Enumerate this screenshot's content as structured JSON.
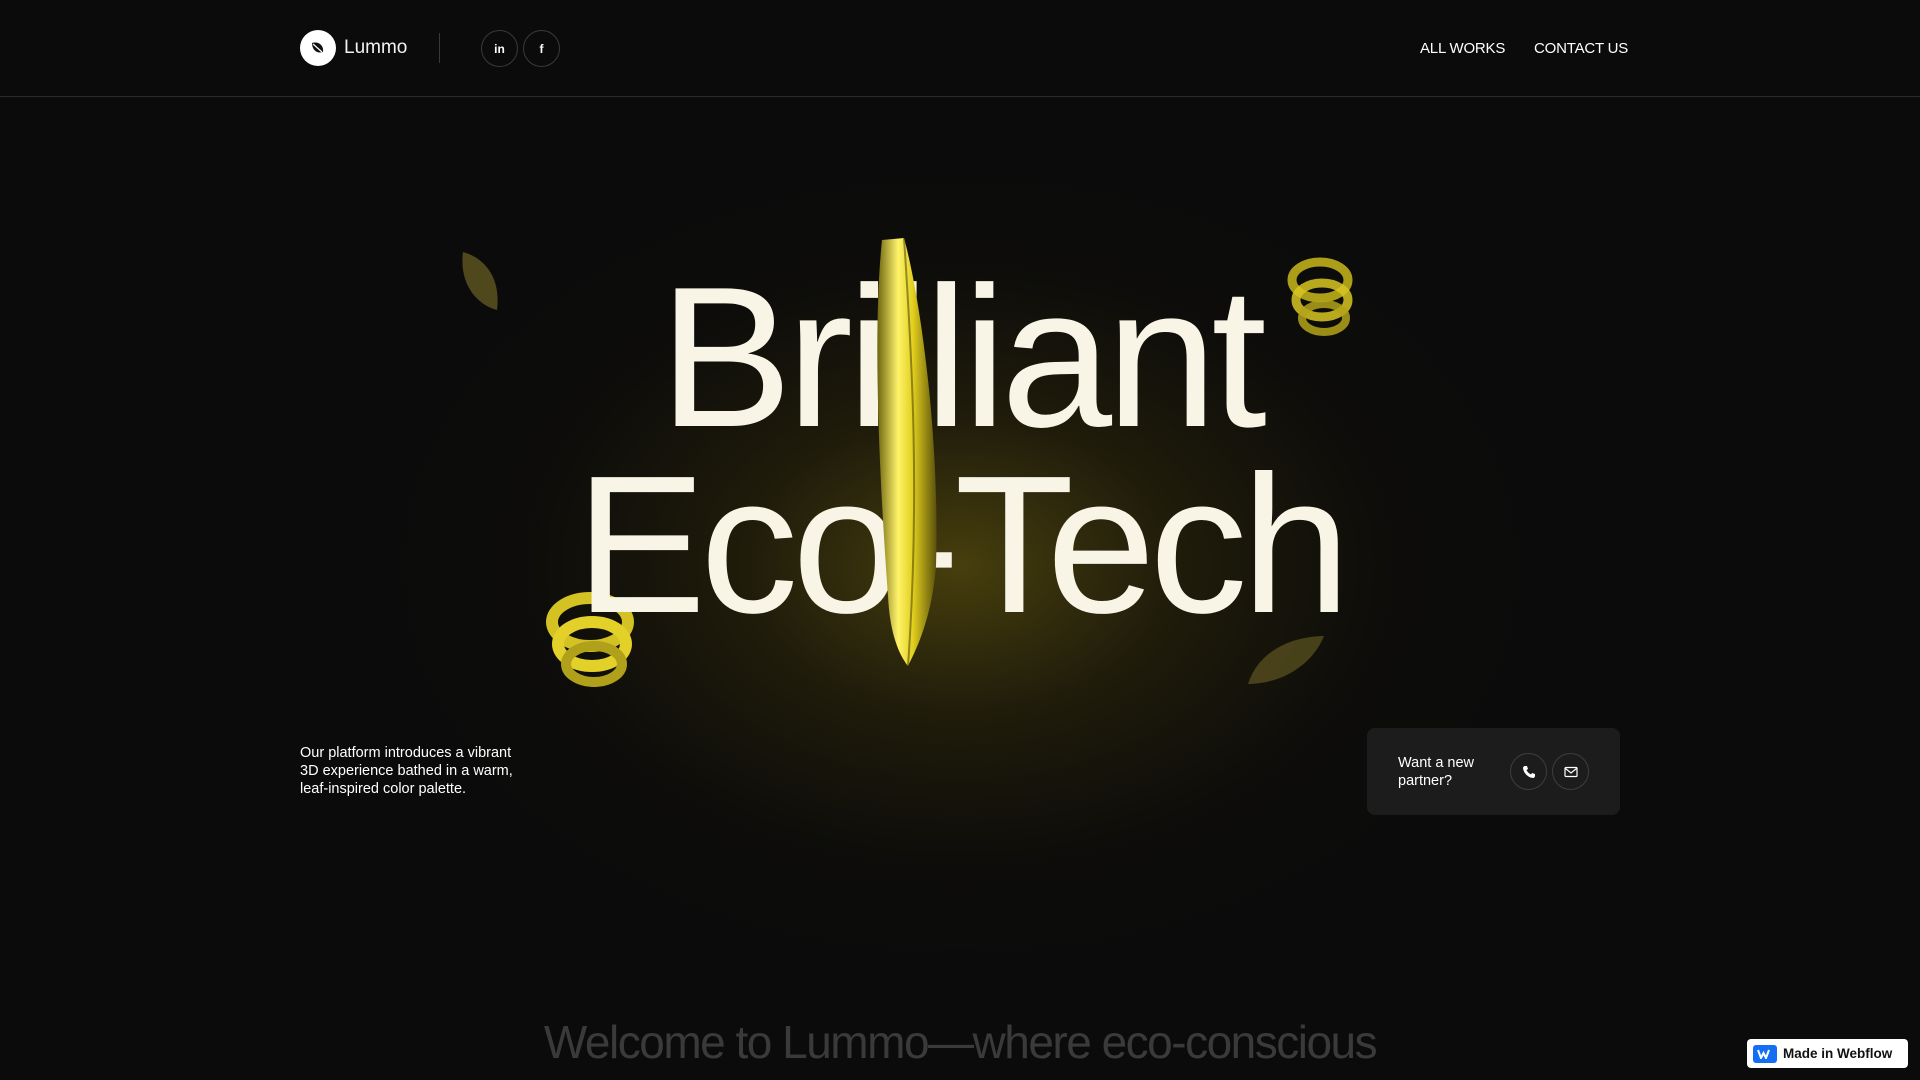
{
  "brand": {
    "name": "Lummo"
  },
  "social": [
    {
      "label": "in",
      "icon": "linkedin-icon"
    },
    {
      "label": "f",
      "icon": "facebook-icon"
    }
  ],
  "nav": {
    "all_works": "ALL WORKS",
    "contact_us": "CONTACT US"
  },
  "hero": {
    "line1": "Brilliant",
    "line2": "Eco-Tech"
  },
  "description": "Our platform introduces a vibrant 3D experience bathed in a warm, leaf-inspired color palette.",
  "partner_card": {
    "text": "Want a new partner?",
    "phone_icon": "phone-icon",
    "mail_icon": "mail-icon"
  },
  "welcome": "Welcome to Lummo—where eco-conscious",
  "webflow_badge": "Made in Webflow",
  "colors": {
    "background": "#0b0b0b",
    "accent": "#e6d21c",
    "hero_text": "#f8f4e6",
    "card": "#1c1c1c"
  }
}
